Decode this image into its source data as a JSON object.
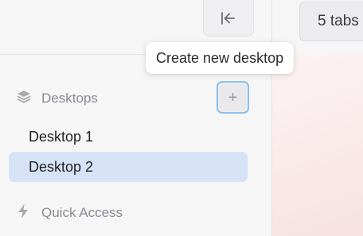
{
  "sidebar": {
    "section_title": "Desktops",
    "section_icon": "layers-icon",
    "collapse_icon": "collapse-left-icon",
    "add_label": "+",
    "items": [
      {
        "label": "Desktop 1",
        "active": false
      },
      {
        "label": "Desktop 2",
        "active": true
      }
    ],
    "quick_access": {
      "label": "Quick Access",
      "icon": "lightning-icon"
    }
  },
  "tooltip": {
    "text": "Create new desktop"
  },
  "header": {
    "tabs_label": "5 tabs"
  },
  "colors": {
    "active_item_bg": "#d6e3f6",
    "focus_ring": "#8cbef0",
    "sidebar_bg": "#f6f6f7"
  }
}
